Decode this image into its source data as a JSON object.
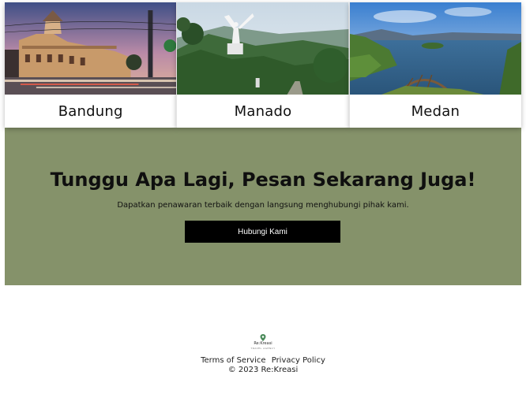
{
  "cities": [
    {
      "name": "Bandung",
      "photo": "bandung-street-photo"
    },
    {
      "name": "Manado",
      "photo": "manado-statue-photo"
    },
    {
      "name": "Medan",
      "photo": "medan-lake-photo"
    }
  ],
  "cta": {
    "title": "Tunggu Apa Lagi, Pesan Sekarang Juga!",
    "subtitle": "Dapatkan penawaran terbaik dengan langsung menghubungi pihak kami.",
    "button_label": "Hubungi Kami"
  },
  "footer": {
    "logo_text": "Re:Kreasi",
    "logo_tagline": "TRAVEL AGENCY",
    "terms_label": "Terms of Service",
    "privacy_label": "Privacy Policy",
    "copyright": "© 2023 Re:Kreasi"
  },
  "colors": {
    "cta_background": "#85926a",
    "button_background": "#000000",
    "logo_green": "#4a8a5a"
  }
}
